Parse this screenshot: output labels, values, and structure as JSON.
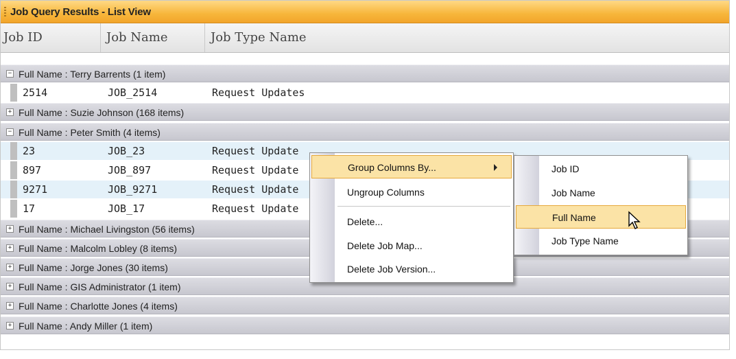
{
  "window": {
    "title": "Job Query Results - List View"
  },
  "columns": [
    "Job ID",
    "Job Name",
    "Job Type Name"
  ],
  "groups": [
    {
      "label": "Full Name : Terry Barrents (1 item)",
      "expanded": true,
      "rows": [
        {
          "id": "2514",
          "name": "JOB_2514",
          "type": "Request Updates"
        }
      ]
    },
    {
      "label": "Full Name : Suzie Johnson (168 items)",
      "expanded": false,
      "rows": []
    },
    {
      "label": "Full Name : Peter Smith (4 items)",
      "expanded": true,
      "rows": [
        {
          "id": "23",
          "name": "JOB_23",
          "type": "Request Update"
        },
        {
          "id": "897",
          "name": "JOB_897",
          "type": "Request Update"
        },
        {
          "id": "9271",
          "name": "JOB_9271",
          "type": "Request Update"
        },
        {
          "id": "17",
          "name": "JOB_17",
          "type": "Request Update"
        }
      ]
    },
    {
      "label": "Full Name : Michael Livingston (56 items)",
      "expanded": false,
      "rows": []
    },
    {
      "label": "Full Name : Malcolm Lobley (8 items)",
      "expanded": false,
      "rows": []
    },
    {
      "label": "Full Name : Jorge Jones (30 items)",
      "expanded": false,
      "rows": []
    },
    {
      "label": "Full Name : GIS Administrator (1 item)",
      "expanded": false,
      "rows": []
    },
    {
      "label": "Full Name : Charlotte Jones (4 items)",
      "expanded": false,
      "rows": []
    },
    {
      "label": "Full Name : Andy Miller (1 item)",
      "expanded": false,
      "rows": []
    }
  ],
  "context_menu": {
    "items": [
      "Group Columns By...",
      "Ungroup Columns",
      "Delete...",
      "Delete Job Map...",
      "Delete Job Version..."
    ],
    "highlighted": "Group Columns By..."
  },
  "submenu": {
    "items": [
      "Job ID",
      "Job Name",
      "Full Name",
      "Job Type Name"
    ],
    "highlighted": "Full Name"
  },
  "colors": {
    "titlebar": "#f7b63b",
    "group_row": "#c7c7cf",
    "alt_row": "#e4f1f9",
    "highlight": "#fbe3a6"
  }
}
